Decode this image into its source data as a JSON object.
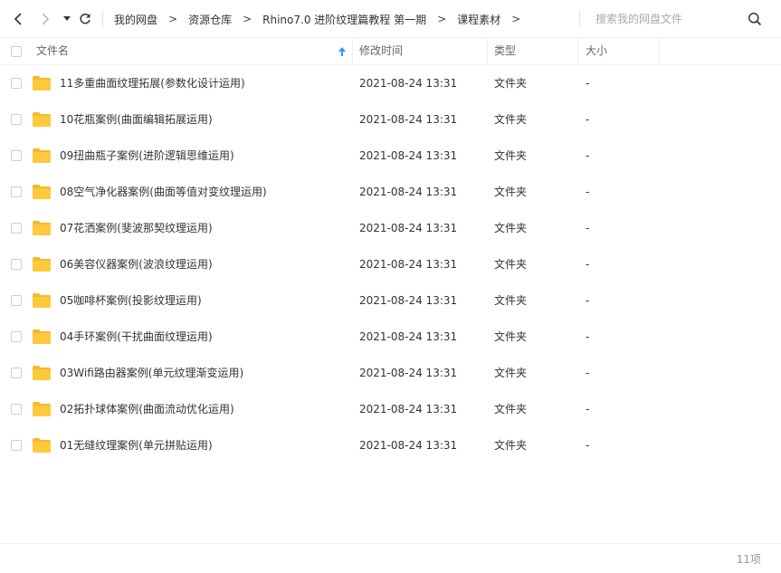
{
  "toolbar": {
    "back_icon": "chevron-left-icon",
    "forward_icon": "chevron-right-icon",
    "history_icon": "caret-down-icon",
    "refresh_icon": "refresh-icon",
    "breadcrumb": [
      "我的网盘",
      "资源仓库",
      "Rhino7.0 进阶纹理篇教程 第一期",
      "课程素材"
    ],
    "crumb_separator": ">"
  },
  "search": {
    "placeholder": "搜索我的网盘文件",
    "icon": "search-icon"
  },
  "columns": {
    "name": "文件名",
    "mtime": "修改时间",
    "type": "类型",
    "size": "大小",
    "sort_icon": "arrow-up-icon"
  },
  "colors": {
    "folder": "#FFC93C",
    "folder_tab": "#F5B82E",
    "sort_arrow": "#2b9bf4"
  },
  "files": [
    {
      "name": "11多重曲面纹理拓展(参数化设计运用)",
      "mtime": "2021-08-24 13:31",
      "type": "文件夹",
      "size": "-"
    },
    {
      "name": "10花瓶案例(曲面编辑拓展运用)",
      "mtime": "2021-08-24 13:31",
      "type": "文件夹",
      "size": "-"
    },
    {
      "name": "09扭曲瓶子案例(进阶逻辑思维运用)",
      "mtime": "2021-08-24 13:31",
      "type": "文件夹",
      "size": "-"
    },
    {
      "name": "08空气净化器案例(曲面等值对变纹理运用)",
      "mtime": "2021-08-24 13:31",
      "type": "文件夹",
      "size": "-"
    },
    {
      "name": "07花洒案例(斐波那契纹理运用)",
      "mtime": "2021-08-24 13:31",
      "type": "文件夹",
      "size": "-"
    },
    {
      "name": "06美容仪器案例(波浪纹理运用)",
      "mtime": "2021-08-24 13:31",
      "type": "文件夹",
      "size": "-"
    },
    {
      "name": "05咖啡杯案例(投影纹理运用)",
      "mtime": "2021-08-24 13:31",
      "type": "文件夹",
      "size": "-"
    },
    {
      "name": "04手环案例(干扰曲面纹理运用)",
      "mtime": "2021-08-24 13:31",
      "type": "文件夹",
      "size": "-"
    },
    {
      "name": "03Wifi路由器案例(单元纹理渐变运用)",
      "mtime": "2021-08-24 13:31",
      "type": "文件夹",
      "size": "-"
    },
    {
      "name": "02拓扑球体案例(曲面流动优化运用)",
      "mtime": "2021-08-24 13:31",
      "type": "文件夹",
      "size": "-"
    },
    {
      "name": "01无缝纹理案例(单元拼贴运用)",
      "mtime": "2021-08-24 13:31",
      "type": "文件夹",
      "size": "-"
    }
  ],
  "footer": {
    "count": "11项"
  }
}
